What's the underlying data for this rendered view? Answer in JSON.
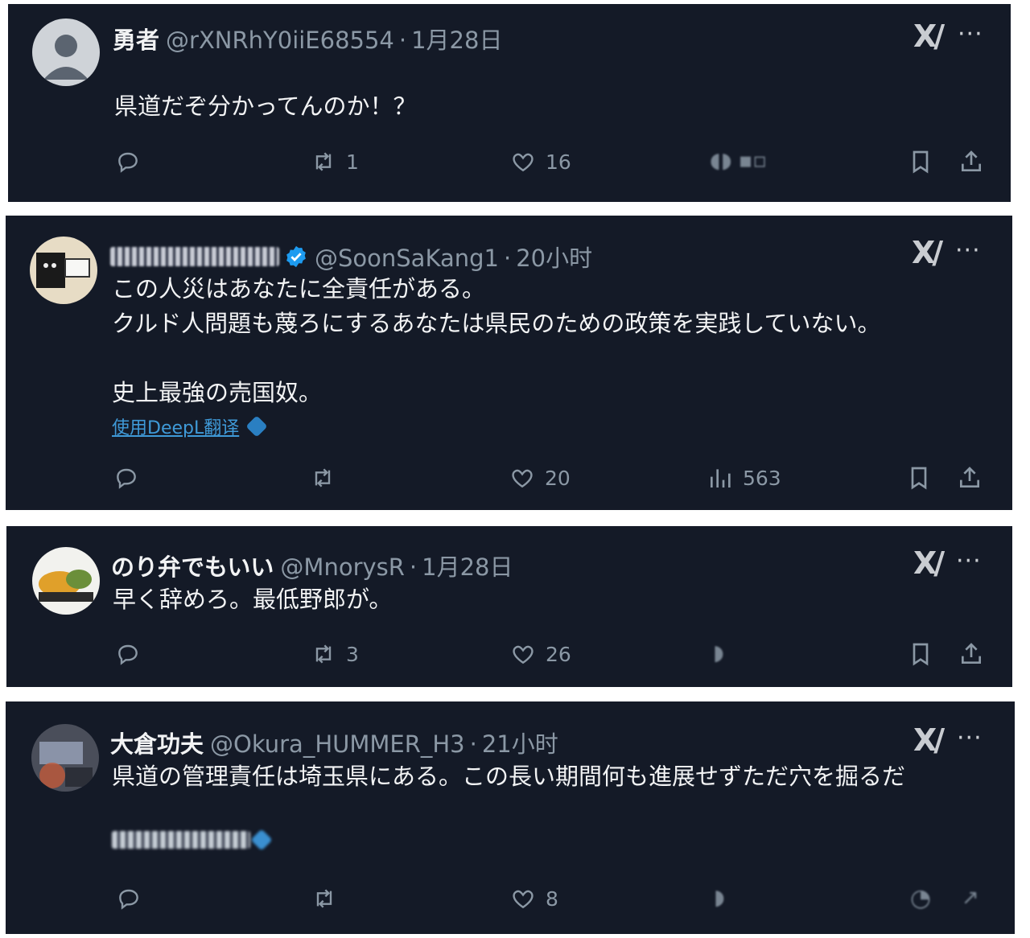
{
  "tweets": [
    {
      "name": "勇者",
      "handle": "@rXNRhY0iiE68554",
      "sep": "·",
      "time": "1月28日",
      "text": "県道だぞ分かってんのか！？",
      "retweets": "1",
      "likes": "16",
      "more": "···",
      "xai": "X/"
    },
    {
      "name": "",
      "handle": "@SoonSaKang1",
      "sep": "·",
      "time": "20小时",
      "text": "この人災はあなたに全責任がある。\nクルド人問題も蔑ろにするあなたは県民のための政策を実践していない。\n\n史上最強の売国奴。",
      "translate": "使用DeepL翻译",
      "likes": "20",
      "views": "563",
      "more": "···",
      "xai": "X/"
    },
    {
      "name": "のり弁でもいい",
      "handle": "@MnorysR",
      "sep": "·",
      "time": "1月28日",
      "text": "早く辞めろ。最低野郎が。",
      "retweets": "3",
      "likes": "26",
      "more": "···",
      "xai": "X/"
    },
    {
      "name": "大倉功夫",
      "handle": "@Okura_HUMMER_H3",
      "sep": "·",
      "time": "21小时",
      "text": "県道の管理責任は埼玉県にある。この長い期間何も進展せずただ穴を掘るだ",
      "likes": "8",
      "more": "···",
      "xai": "X/"
    }
  ],
  "colors": {
    "card_bg": "#141a27",
    "text": "#f2f3f4",
    "muted": "#8b98a5",
    "link": "#3f9ad8",
    "verified": "#1d9bf0"
  },
  "icons": [
    "reply-icon",
    "retweet-icon",
    "like-icon",
    "views-icon",
    "bookmark-icon",
    "share-icon",
    "grok-icon",
    "more-icon",
    "verified-badge-icon"
  ]
}
